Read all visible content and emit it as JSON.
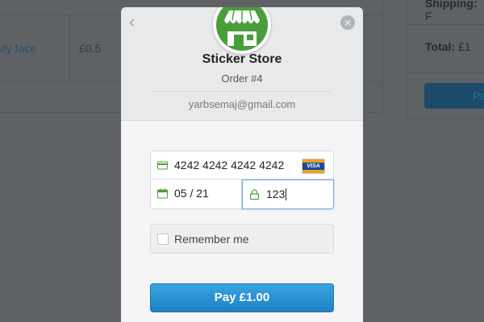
{
  "background": {
    "product_link": "My face",
    "price": "£0.5",
    "shipping_label": "Shipping:",
    "shipping_value": "F",
    "total_label": "Total:",
    "total_value": "£1",
    "pay_button_label": "Pa"
  },
  "modal": {
    "title": "Sticker Store",
    "order": "Order #4",
    "email": "yarbsemaj@gmail.com",
    "card_number": "4242 4242 4242 4242",
    "card_brand": "VISA",
    "expiry": "05 / 21",
    "cvc": "123",
    "remember_label": "Remember me",
    "pay_label": "Pay £1.00",
    "icons": {
      "back": "chevron-left-icon",
      "close": "close-icon",
      "card": "credit-card-icon",
      "calendar": "calendar-icon",
      "lock": "lock-icon",
      "logo": "store-logo"
    },
    "colors": {
      "accent": "#4a9e3a",
      "pay_button": "#2a8fd3"
    }
  }
}
